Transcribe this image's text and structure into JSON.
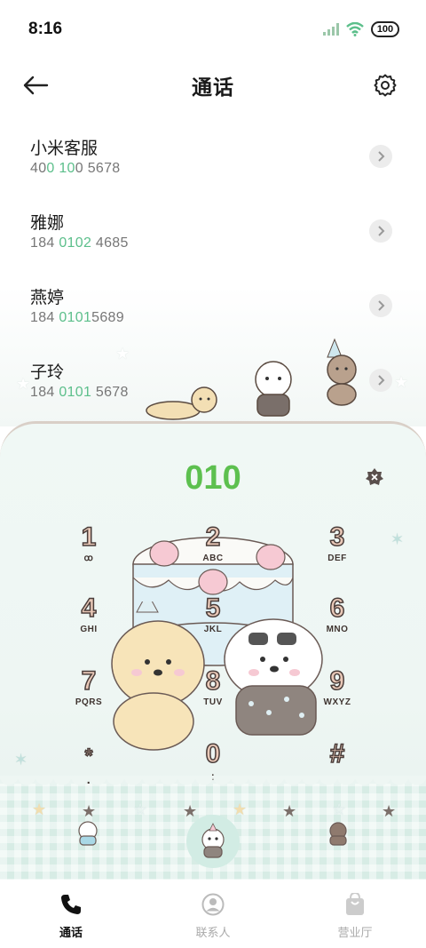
{
  "status_bar": {
    "time": "8:16",
    "battery": "100",
    "icons": [
      "signal-icon",
      "wifi-icon",
      "battery-icon"
    ]
  },
  "header": {
    "title": "通话",
    "back_icon": "arrow-left-icon",
    "settings_icon": "gear-icon"
  },
  "contacts": [
    {
      "name": "小米客服",
      "number_parts": [
        "40",
        "0 10",
        "0 5678"
      ]
    },
    {
      "name": "雅娜",
      "number_parts": [
        "184 ",
        "0102",
        " 4685"
      ]
    },
    {
      "name": "燕婷",
      "number_parts": [
        "184 ",
        "0101",
        "5689"
      ]
    },
    {
      "name": "子玲",
      "number_parts": [
        "184 ",
        "0101",
        " 5678"
      ]
    }
  ],
  "dialer": {
    "input_value": "010",
    "delete_icon": "backspace-icon",
    "keys": [
      {
        "digit": "1",
        "letters": "ꝏ"
      },
      {
        "digit": "2",
        "letters": "ABC"
      },
      {
        "digit": "3",
        "letters": "DEF"
      },
      {
        "digit": "4",
        "letters": "GHI"
      },
      {
        "digit": "5",
        "letters": "JKL"
      },
      {
        "digit": "6",
        "letters": "MNO"
      },
      {
        "digit": "7",
        "letters": "PQRS"
      },
      {
        "digit": "8",
        "letters": "TUV"
      },
      {
        "digit": "9",
        "letters": "WXYZ"
      },
      {
        "digit": "*",
        "letters": ","
      },
      {
        "digit": "0",
        "letters": "+"
      },
      {
        "digit": "#",
        "letters": ""
      }
    ],
    "call_icon": "phone-call-icon"
  },
  "bottom_nav": {
    "items": [
      {
        "label": "通话",
        "icon": "phone-icon",
        "active": true
      },
      {
        "label": "联系人",
        "icon": "person-icon",
        "active": false
      },
      {
        "label": "营业厅",
        "icon": "shopping-bag-icon",
        "active": false
      }
    ]
  },
  "colors": {
    "accent_green": "#5dc04f",
    "highlight_digits": "#5cbf8b",
    "panel_bg": "#eef6f3"
  }
}
